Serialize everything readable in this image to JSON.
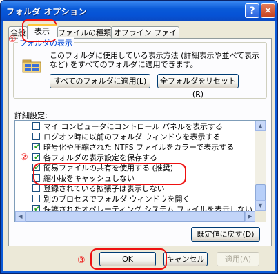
{
  "window": {
    "title": "フォルダ オプション",
    "help_symbol": "?",
    "close_symbol": "✕"
  },
  "tabs": [
    {
      "label": "全般"
    },
    {
      "label": "表示"
    },
    {
      "label": "ファイルの種類"
    },
    {
      "label": "オフライン ファイル"
    }
  ],
  "folder_view": {
    "legend": "フォルダの表示",
    "description": "このフォルダに使用している表示方法 (詳細表示や並べて表示など) をすべてのフォルダに適用できます。",
    "apply_all_button": "すべてのフォルダに適用(L)",
    "reset_all_button": "全フォルダをリセット(R)",
    "icon": "folder-icon"
  },
  "advanced": {
    "label": "詳細設定:",
    "items": [
      {
        "label": "マイ コンピュータにコントロール パネルを表示する",
        "checked": false
      },
      {
        "label": "ログオン時に以前のフォルダ ウィンドウを表示する",
        "checked": false
      },
      {
        "label": "暗号化や圧縮された NTFS ファイルをカラーで表示する",
        "checked": true
      },
      {
        "label": "各フォルダの表示設定を保存する",
        "checked": true
      },
      {
        "label": "簡易ファイルの共有を使用する (推奨)",
        "checked": true
      },
      {
        "label": "縮小版をキャッシュしない",
        "checked": false
      },
      {
        "label": "登録されている拡張子は表示しない",
        "checked": false
      },
      {
        "label": "別のプロセスでフォルダ ウィンドウを開く",
        "checked": false
      },
      {
        "label": "保護されたオペレーティング システム ファイルを表示しない (推奨)",
        "checked": true
      }
    ],
    "scroll_up": "▲",
    "scroll_down": "▼",
    "scroll_left": "◀",
    "scroll_right": "▶"
  },
  "restore_button": "既定値に戻す(D)",
  "buttons": {
    "ok": "OK",
    "cancel": "キャンセル",
    "apply": "適用(A)"
  },
  "annotations": {
    "step1": "①",
    "step2": "②",
    "step3": "③",
    "color": "#ee1111"
  }
}
